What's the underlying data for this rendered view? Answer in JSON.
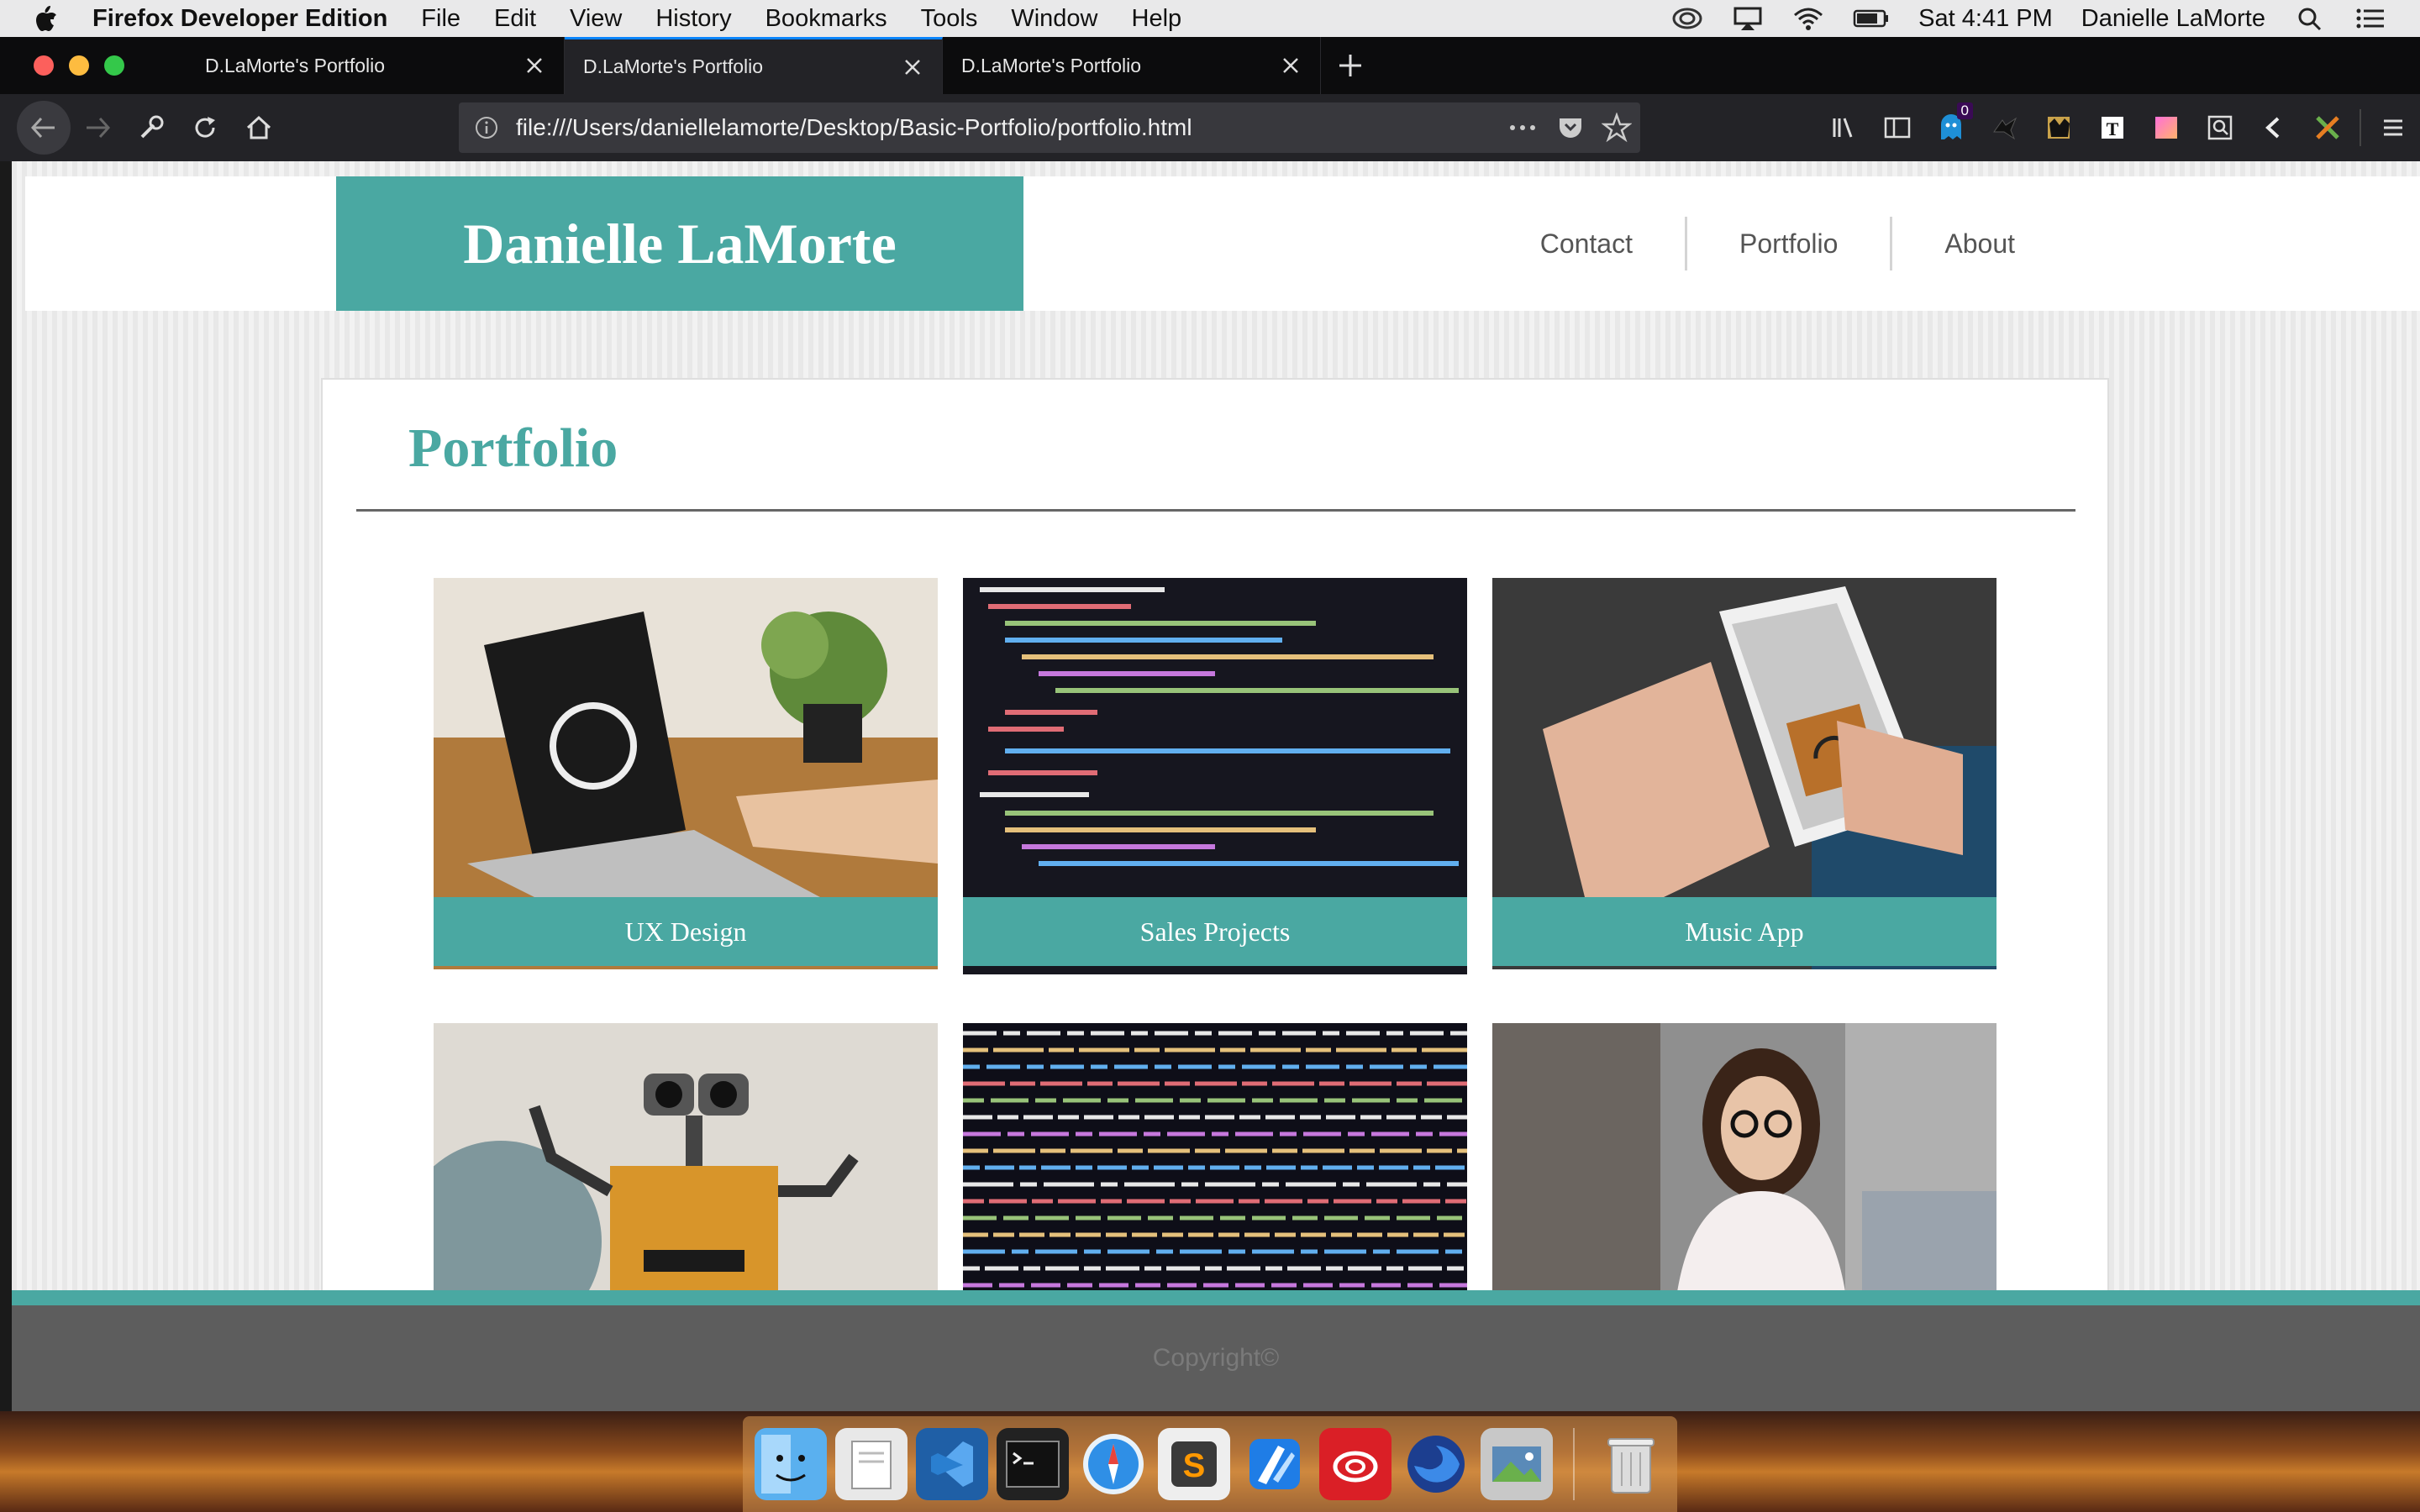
{
  "menubar": {
    "app_name": "Firefox Developer Edition",
    "items": [
      "File",
      "Edit",
      "View",
      "History",
      "Bookmarks",
      "Tools",
      "Window",
      "Help"
    ],
    "clock": "Sat 4:41 PM",
    "user": "Danielle LaMorte",
    "icons": [
      "creative-cloud-icon",
      "airplay-icon",
      "wifi-icon",
      "battery-icon",
      "spotlight-icon",
      "notification-center-icon"
    ]
  },
  "browser": {
    "tabs": [
      {
        "title": "D.LaMorte's Portfolio",
        "active": false
      },
      {
        "title": "D.LaMorte's Portfolio",
        "active": true
      },
      {
        "title": "D.LaMorte's Portfolio",
        "active": false
      }
    ],
    "url": "file:///Users/daniellelamorte/Desktop/Basic-Portfolio/portfolio.html",
    "toolbar_badge": "0",
    "toolbar_icons": [
      "library-icon",
      "sidebar-icon",
      "ghostery-icon",
      "extension-bird-icon",
      "extension-cat-icon",
      "extension-t-icon",
      "extension-gradient-icon",
      "extension-inspect-icon",
      "extension-chevron-icon",
      "extension-x-icon",
      "menu-icon"
    ]
  },
  "site": {
    "logo": "Danielle LaMorte",
    "nav": [
      "Contact",
      "Portfolio",
      "About"
    ],
    "heading": "Portfolio",
    "projects": [
      {
        "caption": "UX Design",
        "image": "laptop-photo"
      },
      {
        "caption": "Sales Projects",
        "image": "code-photo"
      },
      {
        "caption": "Music App",
        "image": "phone-photo"
      },
      {
        "caption": "",
        "image": "robot-photo"
      },
      {
        "caption": "",
        "image": "code-dense-photo"
      },
      {
        "caption": "",
        "image": "woman-laptop-photo"
      }
    ],
    "footer": "Copyright©"
  },
  "colors": {
    "accent": "#4aa8a2",
    "footer": "#5d5d5d",
    "tab_highlight": "#0a84ff"
  },
  "dock": [
    "Finder",
    "Preview",
    "Visual Studio Code",
    "Terminal",
    "Safari",
    "Sublime Text",
    "Xcode",
    "Creative Cloud",
    "Firefox Developer Edition",
    "Image Capture",
    "Trash"
  ]
}
